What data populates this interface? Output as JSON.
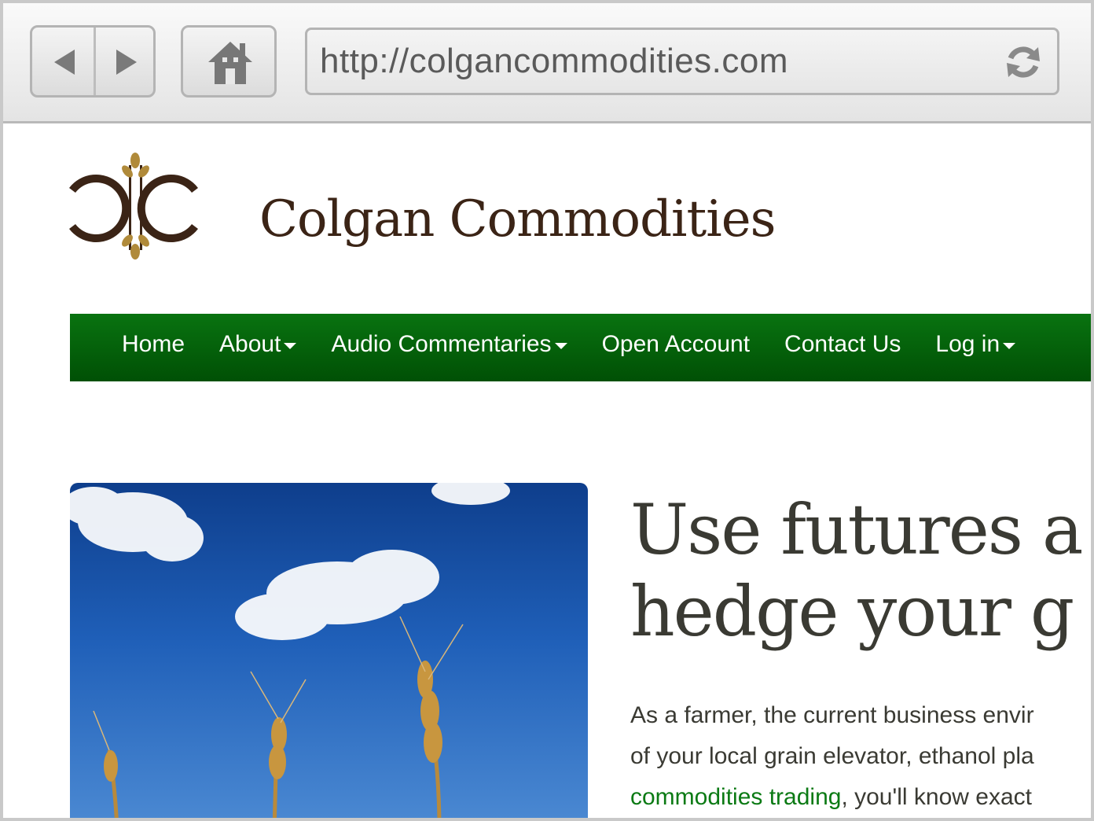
{
  "browser": {
    "url": "http://colgancommodities.com",
    "icons": {
      "back": "back-arrow-icon",
      "forward": "forward-arrow-icon",
      "home": "home-icon",
      "reload": "reload-icon"
    }
  },
  "header": {
    "site_title": "Colgan Commodities",
    "logo_icon": "wheat-cc-logo",
    "colors": {
      "title": "#3b2416",
      "logo_gold": "#b08a3a"
    }
  },
  "nav": {
    "items": [
      {
        "label": "Home",
        "has_dropdown": false
      },
      {
        "label": "About",
        "has_dropdown": true
      },
      {
        "label": "Audio Commentaries",
        "has_dropdown": true
      },
      {
        "label": "Open Account",
        "has_dropdown": false
      },
      {
        "label": "Contact Us",
        "has_dropdown": false
      },
      {
        "label": "Log in",
        "has_dropdown": true
      }
    ],
    "colors": {
      "bar": "#097310"
    }
  },
  "hero": {
    "headline_line1": "Use futures a",
    "headline_line2": "hedge your g",
    "body_line1": "As a farmer, the current business envir",
    "body_line2": "of your local grain elevator, ethanol pla",
    "body_link": "commodities trading",
    "body_line3_rest": ", you'll know exact",
    "colors": {
      "link": "#0b7a14",
      "text": "#3a3a33"
    }
  }
}
